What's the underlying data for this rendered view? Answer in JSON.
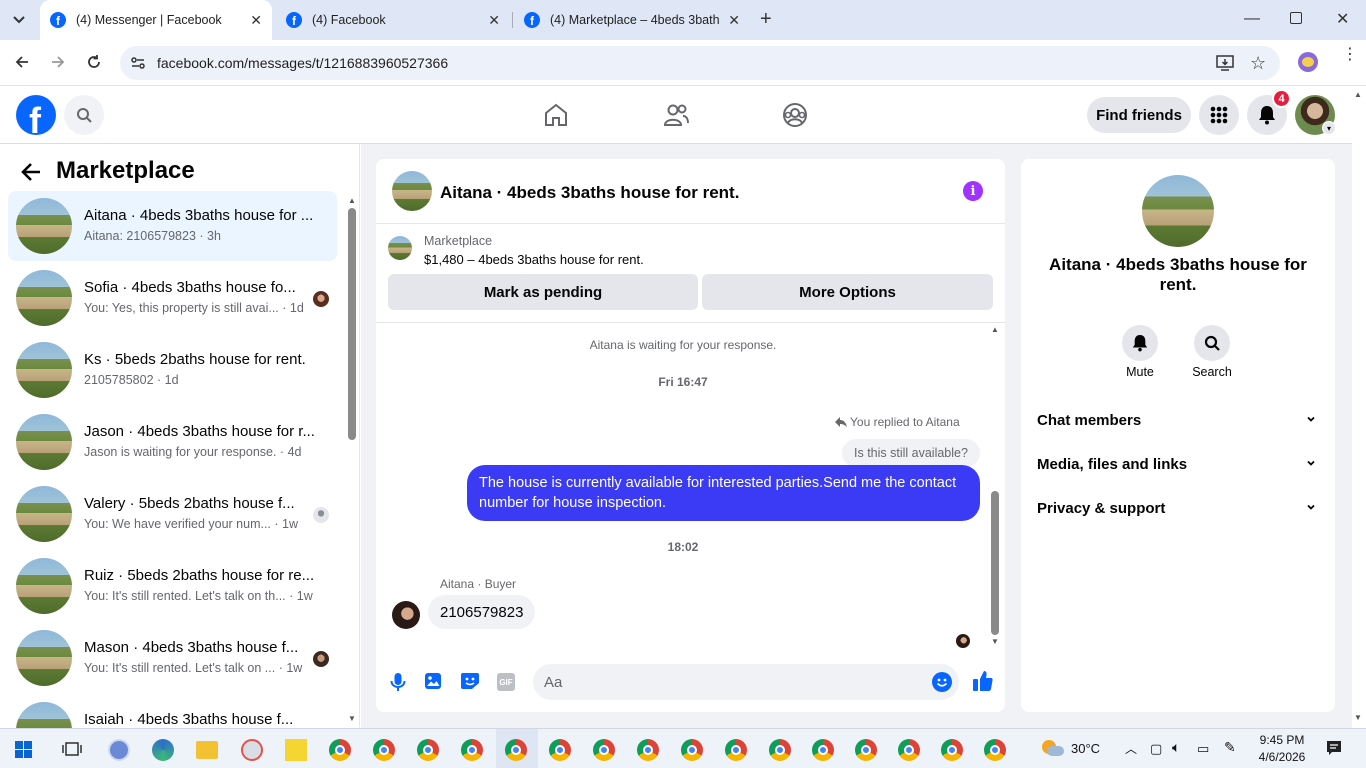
{
  "browser": {
    "tabs": [
      {
        "title": "(4) Messenger | Facebook",
        "active": true
      },
      {
        "title": "(4) Facebook",
        "active": false
      },
      {
        "title": "(4) Marketplace – 4beds 3baths",
        "active": false
      }
    ],
    "new_tab": "+",
    "url": "facebook.com/messages/t/1216883960527366"
  },
  "fb_header": {
    "logo": "f",
    "find_friends": "Find friends",
    "notification_count": "4"
  },
  "left_panel": {
    "title": "Marketplace",
    "conversations": [
      {
        "name": "Aitana · 4beds 3baths house for ...",
        "snippet": "Aitana: 2106579823 · 3h",
        "selected": true
      },
      {
        "name": "Sofia · 4beds 3baths house fo...",
        "snippet": "You: Yes, this property is still avai... · 1d"
      },
      {
        "name": "Ks · 5beds 2baths house for rent.",
        "snippet": "2105785802 · 1d"
      },
      {
        "name": "Jason · 4beds 3baths house for r...",
        "snippet": "Jason is waiting for your response. · 4d"
      },
      {
        "name": "Valery · 5beds 2baths house f...",
        "snippet": "You: We have verified your num... · 1w"
      },
      {
        "name": "Ruiz · 5beds 2baths house for re...",
        "snippet": "You: It's still rented. Let's talk on th... · 1w"
      },
      {
        "name": "Mason · 4beds 3baths house f...",
        "snippet": "You: It's still rented. Let's talk on ... · 1w"
      },
      {
        "name": "Isaiah · 4beds 3baths house f...",
        "snippet": ""
      }
    ]
  },
  "chat": {
    "title": "Aitana · 4beds 3baths house for rent.",
    "listing_source": "Marketplace",
    "listing_line": "$1,480 – 4beds 3baths house for rent.",
    "mark_pending": "Mark as pending",
    "more_options": "More Options",
    "waiting_note": "Aitana is waiting for your response.",
    "time1": "Fri 16:47",
    "replied_note": "You replied to Aitana",
    "quoted_message": "Is this still available?",
    "my_message": "The house is currently available for interested parties.Send me the contact number for house inspection.",
    "time2": "18:02",
    "sender_label": "Aitana · Buyer",
    "their_message": "2106579823",
    "composer_placeholder": "Aa"
  },
  "info_panel": {
    "title": "Aitana · 4beds 3baths house for rent.",
    "mute_label": "Mute",
    "search_label": "Search",
    "sections": [
      "Chat members",
      "Media, files and links",
      "Privacy & support"
    ]
  },
  "taskbar": {
    "weather": "30°C",
    "time": "9:45 PM",
    "date": "4/6/2026"
  },
  "colors": {
    "fb_blue": "#0866ff",
    "messenger_purple": "#a033ff",
    "outgoing_bubble": "#3b3bf5",
    "notif_red": "#e41e3f"
  }
}
